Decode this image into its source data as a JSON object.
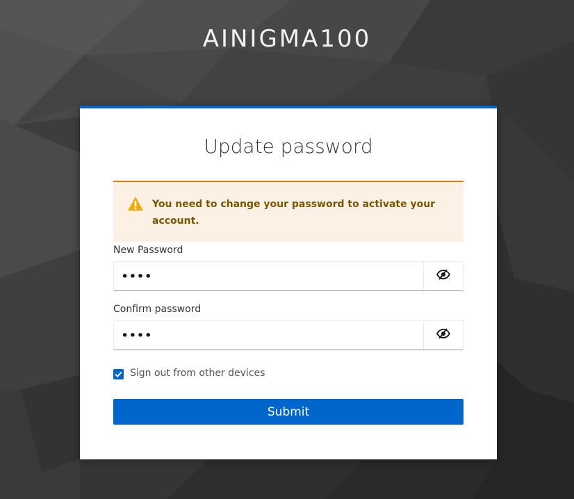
{
  "realm": {
    "title": "AINIGMA100"
  },
  "form": {
    "title": "Update password",
    "alert": {
      "icon": "warning-icon",
      "message": "You need to change your password to activate your account.",
      "accent_color": "#ec7a08"
    },
    "new_password": {
      "label": "New Password",
      "value": "pass",
      "toggle_icon": "eye-slash-icon"
    },
    "confirm_password": {
      "label": "Confirm password",
      "value": "pass",
      "toggle_icon": "eye-slash-icon"
    },
    "logout_sessions": {
      "label": "Sign out from other devices",
      "checked": true
    },
    "submit_label": "Submit"
  },
  "colors": {
    "primary": "#0066cc",
    "background": "#3b3b3b"
  }
}
